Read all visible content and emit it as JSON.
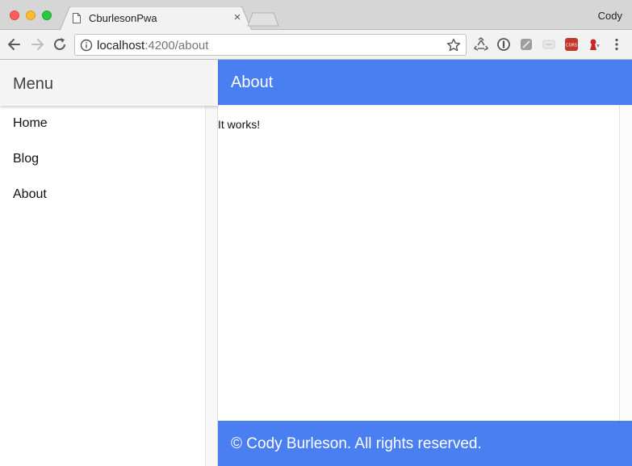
{
  "browser": {
    "tab": {
      "title": "CburlesonPwa",
      "close_label": "×"
    },
    "profile_name": "Cody",
    "address": {
      "host": "localhost",
      "path": ":4200/about"
    },
    "icons": [
      "back-arrow-icon",
      "forward-arrow-icon",
      "reload-icon",
      "info-icon",
      "star-icon",
      "recycle-icon",
      "onepassword-icon",
      "extension-icon",
      "cast-icon",
      "cors-icon",
      "extension-red-icon",
      "kebab-menu-icon"
    ],
    "colors": {
      "tab_bar": "#d6d6d6",
      "toolbar": "#f2f2f2"
    }
  },
  "app": {
    "sidenav": {
      "title": "Menu",
      "items": [
        {
          "label": "Home"
        },
        {
          "label": "Blog"
        },
        {
          "label": "About"
        }
      ]
    },
    "appbar": {
      "title": "About"
    },
    "content": {
      "text": "It works!"
    },
    "footer": {
      "text": "© Cody Burleson. All rights reserved."
    },
    "colors": {
      "primary": "#4a7ff2",
      "sidenav_header": "#f5f5f5"
    }
  }
}
